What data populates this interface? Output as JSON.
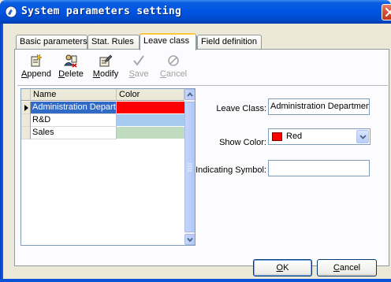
{
  "window": {
    "title": "System parameters setting",
    "icons": {
      "app": "app-globe-icon",
      "close": "close-icon"
    }
  },
  "tabs": [
    {
      "label": "Basic parameters",
      "active": false
    },
    {
      "label": "Stat. Rules",
      "active": false
    },
    {
      "label": "Leave class",
      "active": true
    },
    {
      "label": "Field definition",
      "active": false
    }
  ],
  "toolbar": {
    "append": {
      "label_first": "A",
      "label_rest": "ppend",
      "icon": "append-icon",
      "enabled": true
    },
    "delete": {
      "label_first": "D",
      "label_rest": "elete",
      "icon": "delete-icon",
      "enabled": true
    },
    "modify": {
      "label_first": "M",
      "label_rest": "odify",
      "icon": "modify-icon",
      "enabled": true
    },
    "save": {
      "label_first": "S",
      "label_rest": "ave",
      "icon": "checkmark-icon",
      "enabled": false
    },
    "cancel": {
      "label_first": "C",
      "label_rest": "ancel",
      "icon": "cancel-icon",
      "enabled": false
    }
  },
  "grid": {
    "columns": [
      "Name",
      "Color"
    ],
    "rows": [
      {
        "name": "Administration Departm",
        "color": "#ff0000",
        "selected": true
      },
      {
        "name": "R&D",
        "color": "#a6caf0",
        "selected": false
      },
      {
        "name": "Sales",
        "color": "#c0dcc0",
        "selected": false
      }
    ],
    "row_indicator": "▶"
  },
  "form": {
    "leave_class_label": "Leave Class:",
    "leave_class_value": "Administration Department",
    "show_color_label": "Show Color:",
    "show_color_value": "Red",
    "show_color_swatch": "#ff0000",
    "indicating_symbol_label": "Indicating Symbol:",
    "indicating_symbol_value": ""
  },
  "buttons": {
    "ok": {
      "label_first": "O",
      "label_rest": "K"
    },
    "cancel": {
      "label_first": "C",
      "label_rest": "ancel"
    }
  },
  "colors": {
    "titlebar": "#0054e3",
    "selection": "#316ac5",
    "tab_highlight": "#ffc83c"
  }
}
